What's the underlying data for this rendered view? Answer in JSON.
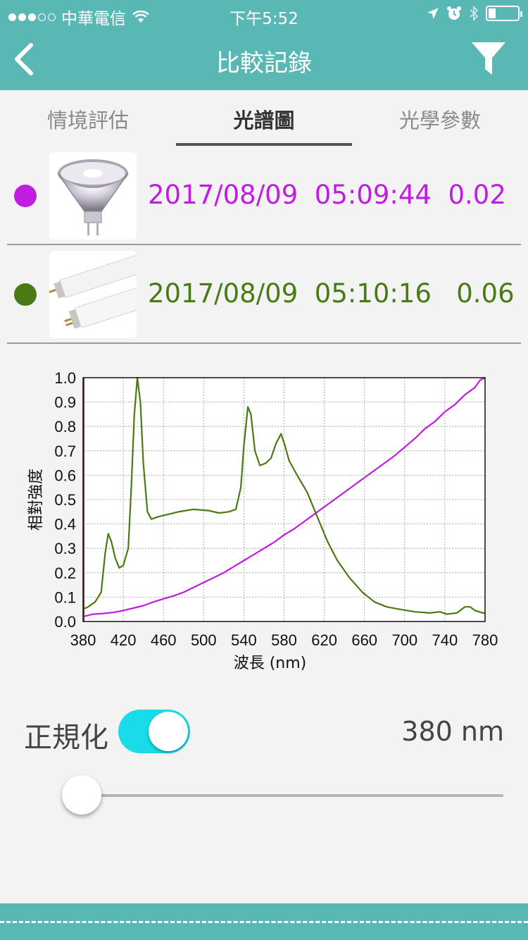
{
  "status_bar": {
    "carrier": "中華電信",
    "time": "下午5:52",
    "battery_percent": 25
  },
  "nav": {
    "title": "比較記錄",
    "back_icon": "chevron-left-icon",
    "filter_icon": "funnel-icon"
  },
  "tabs": [
    {
      "label": "情境評估",
      "active": false
    },
    {
      "label": "光譜圖",
      "active": true
    },
    {
      "label": "光學參數",
      "active": false
    }
  ],
  "records": [
    {
      "datetime": "2017/08/09  05:09:44",
      "value": "0.02",
      "color": "#c11de0",
      "thumb": "halogen-bulb"
    },
    {
      "datetime": "2017/08/09  05:10:16",
      "value": "0.06",
      "color": "#4a7a14",
      "thumb": "fluorescent-tube"
    }
  ],
  "chart_data": {
    "type": "line",
    "xlabel": "波長 (nm)",
    "ylabel": "相對強度",
    "xlim": [
      380,
      780
    ],
    "ylim": [
      0,
      1.0
    ],
    "xticks": [
      "380",
      "420",
      "460",
      "500",
      "540",
      "580",
      "620",
      "660",
      "700",
      "740",
      "780"
    ],
    "yticks": [
      "0.0",
      "0.1",
      "0.2",
      "0.3",
      "0.4",
      "0.5",
      "0.6",
      "0.7",
      "0.8",
      "0.9",
      "1.0"
    ],
    "grid": true,
    "series": [
      {
        "color": "#c11de0",
        "points": [
          [
            380,
            0.02
          ],
          [
            390,
            0.03
          ],
          [
            400,
            0.033
          ],
          [
            410,
            0.037
          ],
          [
            420,
            0.045
          ],
          [
            430,
            0.055
          ],
          [
            440,
            0.065
          ],
          [
            450,
            0.08
          ],
          [
            460,
            0.093
          ],
          [
            470,
            0.105
          ],
          [
            480,
            0.12
          ],
          [
            490,
            0.14
          ],
          [
            500,
            0.16
          ],
          [
            510,
            0.18
          ],
          [
            520,
            0.2
          ],
          [
            530,
            0.225
          ],
          [
            540,
            0.25
          ],
          [
            550,
            0.275
          ],
          [
            560,
            0.3
          ],
          [
            570,
            0.325
          ],
          [
            580,
            0.355
          ],
          [
            590,
            0.38
          ],
          [
            600,
            0.41
          ],
          [
            610,
            0.44
          ],
          [
            620,
            0.47
          ],
          [
            630,
            0.5
          ],
          [
            640,
            0.53
          ],
          [
            650,
            0.56
          ],
          [
            660,
            0.59
          ],
          [
            670,
            0.62
          ],
          [
            680,
            0.65
          ],
          [
            690,
            0.68
          ],
          [
            700,
            0.715
          ],
          [
            710,
            0.75
          ],
          [
            720,
            0.79
          ],
          [
            730,
            0.82
          ],
          [
            740,
            0.86
          ],
          [
            750,
            0.89
          ],
          [
            760,
            0.93
          ],
          [
            770,
            0.96
          ],
          [
            775,
            0.99
          ],
          [
            780,
            1.0
          ]
        ]
      },
      {
        "color": "#4a7a14",
        "points": [
          [
            380,
            0.05
          ],
          [
            385,
            0.06
          ],
          [
            392,
            0.08
          ],
          [
            398,
            0.12
          ],
          [
            402,
            0.28
          ],
          [
            405,
            0.36
          ],
          [
            408,
            0.33
          ],
          [
            412,
            0.26
          ],
          [
            416,
            0.22
          ],
          [
            420,
            0.23
          ],
          [
            425,
            0.3
          ],
          [
            428,
            0.55
          ],
          [
            431,
            0.85
          ],
          [
            434,
            1.0
          ],
          [
            437,
            0.9
          ],
          [
            440,
            0.65
          ],
          [
            444,
            0.45
          ],
          [
            448,
            0.42
          ],
          [
            455,
            0.43
          ],
          [
            465,
            0.44
          ],
          [
            475,
            0.45
          ],
          [
            490,
            0.46
          ],
          [
            505,
            0.455
          ],
          [
            515,
            0.445
          ],
          [
            525,
            0.45
          ],
          [
            532,
            0.46
          ],
          [
            537,
            0.55
          ],
          [
            540,
            0.72
          ],
          [
            544,
            0.88
          ],
          [
            547,
            0.85
          ],
          [
            551,
            0.7
          ],
          [
            556,
            0.64
          ],
          [
            562,
            0.65
          ],
          [
            567,
            0.67
          ],
          [
            572,
            0.73
          ],
          [
            577,
            0.77
          ],
          [
            581,
            0.72
          ],
          [
            585,
            0.66
          ],
          [
            593,
            0.6
          ],
          [
            603,
            0.53
          ],
          [
            613,
            0.43
          ],
          [
            623,
            0.33
          ],
          [
            633,
            0.25
          ],
          [
            645,
            0.18
          ],
          [
            658,
            0.12
          ],
          [
            670,
            0.08
          ],
          [
            682,
            0.06
          ],
          [
            695,
            0.05
          ],
          [
            710,
            0.04
          ],
          [
            725,
            0.035
          ],
          [
            735,
            0.04
          ],
          [
            742,
            0.03
          ],
          [
            752,
            0.035
          ],
          [
            760,
            0.06
          ],
          [
            765,
            0.06
          ],
          [
            770,
            0.045
          ],
          [
            778,
            0.035
          ],
          [
            780,
            0.035
          ]
        ]
      }
    ]
  },
  "controls": {
    "normalize_label": "正規化",
    "normalize_on": true,
    "wavelength_value": "380 nm",
    "slider_fraction": 0.0
  }
}
